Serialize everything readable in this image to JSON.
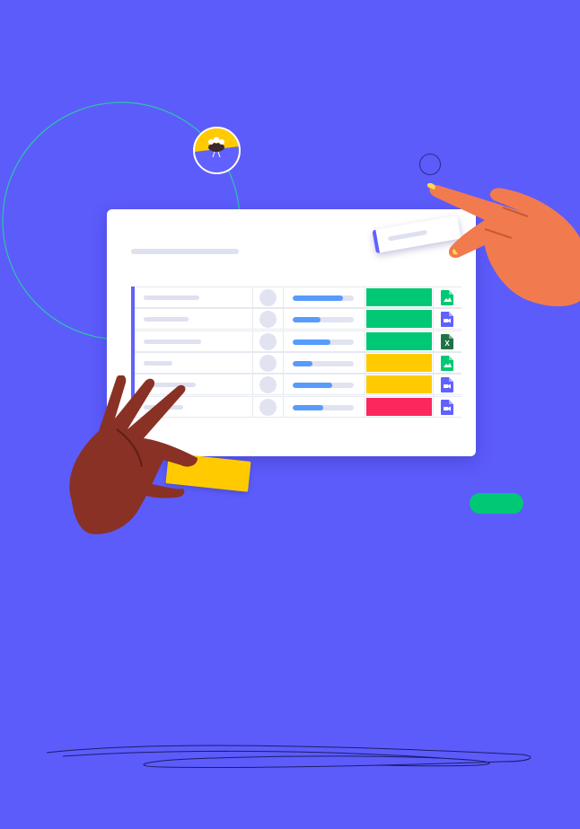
{
  "illustration": {
    "background_color": "#5c5cfb",
    "accent_color": "#6161ff",
    "board": {
      "rows": [
        {
          "progress": 0.82,
          "status_color": "#00c875",
          "file_icon": "image-file-icon",
          "file_color": "#00c875"
        },
        {
          "progress": 0.45,
          "status_color": "#00c875",
          "file_icon": "video-file-icon",
          "file_color": "#6161ff"
        },
        {
          "progress": 0.62,
          "status_color": "#00c875",
          "file_icon": "excel-file-icon",
          "file_color": "#1f7244",
          "file_letter": "X"
        },
        {
          "progress": 0.32,
          "status_color": "#ffcb00",
          "file_icon": "image-file-icon",
          "file_color": "#00c875"
        },
        {
          "progress": 0.65,
          "status_color": "#ffcb00",
          "file_icon": "video-file-icon",
          "file_color": "#6161ff"
        },
        {
          "progress": 0.5,
          "status_color": "#fb275d",
          "file_icon": "video-file-icon",
          "file_color": "#6161ff"
        }
      ]
    },
    "pill_color": "#00c875",
    "card_color": "#ffcb00",
    "icons": [
      "cursor-ring-icon",
      "yellow-badge-icon",
      "dark-hand-illustration",
      "orange-hand-illustration",
      "scribble-shadow"
    ]
  }
}
